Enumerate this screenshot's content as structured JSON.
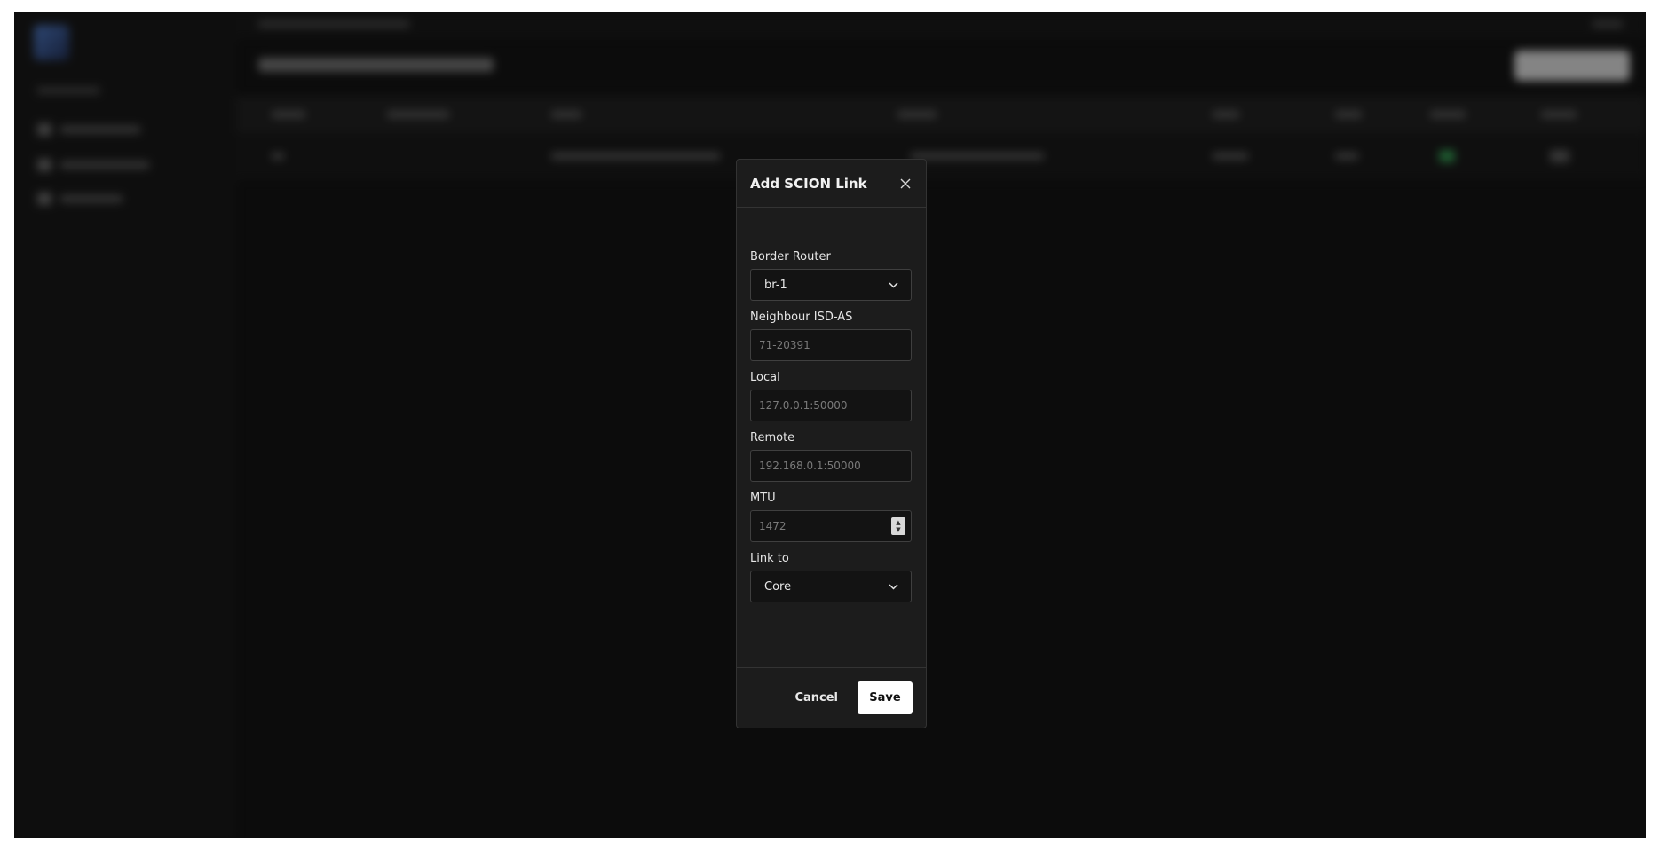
{
  "modal": {
    "title": "Add SCION Link",
    "fields": {
      "border_router": {
        "label": "Border Router",
        "value": "br-1"
      },
      "neighbour_isd_as": {
        "label": "Neighbour ISD-AS",
        "placeholder": "71-20391"
      },
      "local": {
        "label": "Local",
        "placeholder": "127.0.0.1:50000"
      },
      "remote": {
        "label": "Remote",
        "placeholder": "192.168.0.1:50000"
      },
      "mtu": {
        "label": "MTU",
        "placeholder": "1472"
      },
      "link_to": {
        "label": "Link to",
        "value": "Core"
      }
    },
    "footer": {
      "cancel_label": "Cancel",
      "save_label": "Save"
    }
  },
  "icons": {
    "close": "close-icon",
    "chevron": "chevron-down-icon",
    "stepper": "number-stepper-icon"
  },
  "colors": {
    "backdrop": "#0c0c0c",
    "modal_bg": "#1c1c1c",
    "primary_button": "#ffffff"
  }
}
